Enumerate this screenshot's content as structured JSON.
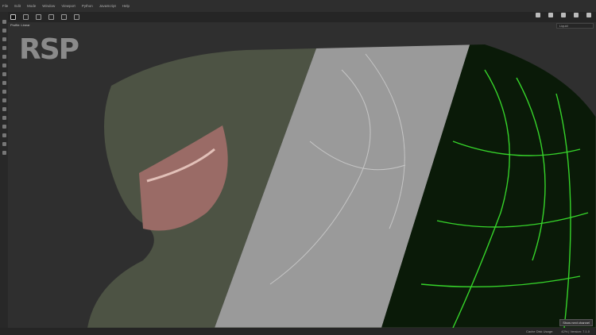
{
  "menu": [
    "File",
    "Edit",
    "Mode",
    "Window",
    "Viewport",
    "Python",
    "JavaScript",
    "Help"
  ],
  "viewport": {
    "profile": "Profile: Linear",
    "channel": "Liquid",
    "logo": "RSP",
    "tooltip": "Show next channel"
  },
  "status": {
    "cache": "Cache Disk Usage:",
    "version": "42% | Version: 7.1.0"
  }
}
